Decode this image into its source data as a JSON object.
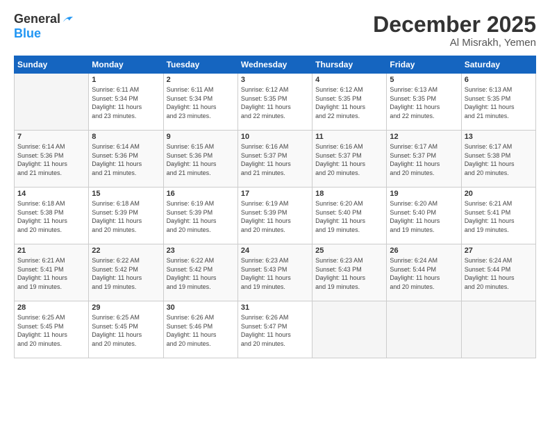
{
  "logo": {
    "line1": "General",
    "line2": "Blue"
  },
  "header": {
    "month": "December 2025",
    "location": "Al Misrakh, Yemen"
  },
  "days_of_week": [
    "Sunday",
    "Monday",
    "Tuesday",
    "Wednesday",
    "Thursday",
    "Friday",
    "Saturday"
  ],
  "weeks": [
    [
      {
        "day": "",
        "empty": true
      },
      {
        "day": "1",
        "sunrise": "6:11 AM",
        "sunset": "5:34 PM",
        "daylight": "11 hours and 23 minutes."
      },
      {
        "day": "2",
        "sunrise": "6:11 AM",
        "sunset": "5:34 PM",
        "daylight": "11 hours and 23 minutes."
      },
      {
        "day": "3",
        "sunrise": "6:12 AM",
        "sunset": "5:35 PM",
        "daylight": "11 hours and 22 minutes."
      },
      {
        "day": "4",
        "sunrise": "6:12 AM",
        "sunset": "5:35 PM",
        "daylight": "11 hours and 22 minutes."
      },
      {
        "day": "5",
        "sunrise": "6:13 AM",
        "sunset": "5:35 PM",
        "daylight": "11 hours and 22 minutes."
      },
      {
        "day": "6",
        "sunrise": "6:13 AM",
        "sunset": "5:35 PM",
        "daylight": "11 hours and 21 minutes."
      }
    ],
    [
      {
        "day": "7",
        "sunrise": "6:14 AM",
        "sunset": "5:36 PM",
        "daylight": "11 hours and 21 minutes."
      },
      {
        "day": "8",
        "sunrise": "6:14 AM",
        "sunset": "5:36 PM",
        "daylight": "11 hours and 21 minutes."
      },
      {
        "day": "9",
        "sunrise": "6:15 AM",
        "sunset": "5:36 PM",
        "daylight": "11 hours and 21 minutes."
      },
      {
        "day": "10",
        "sunrise": "6:16 AM",
        "sunset": "5:37 PM",
        "daylight": "11 hours and 21 minutes."
      },
      {
        "day": "11",
        "sunrise": "6:16 AM",
        "sunset": "5:37 PM",
        "daylight": "11 hours and 20 minutes."
      },
      {
        "day": "12",
        "sunrise": "6:17 AM",
        "sunset": "5:37 PM",
        "daylight": "11 hours and 20 minutes."
      },
      {
        "day": "13",
        "sunrise": "6:17 AM",
        "sunset": "5:38 PM",
        "daylight": "11 hours and 20 minutes."
      }
    ],
    [
      {
        "day": "14",
        "sunrise": "6:18 AM",
        "sunset": "5:38 PM",
        "daylight": "11 hours and 20 minutes."
      },
      {
        "day": "15",
        "sunrise": "6:18 AM",
        "sunset": "5:39 PM",
        "daylight": "11 hours and 20 minutes."
      },
      {
        "day": "16",
        "sunrise": "6:19 AM",
        "sunset": "5:39 PM",
        "daylight": "11 hours and 20 minutes."
      },
      {
        "day": "17",
        "sunrise": "6:19 AM",
        "sunset": "5:39 PM",
        "daylight": "11 hours and 20 minutes."
      },
      {
        "day": "18",
        "sunrise": "6:20 AM",
        "sunset": "5:40 PM",
        "daylight": "11 hours and 19 minutes."
      },
      {
        "day": "19",
        "sunrise": "6:20 AM",
        "sunset": "5:40 PM",
        "daylight": "11 hours and 19 minutes."
      },
      {
        "day": "20",
        "sunrise": "6:21 AM",
        "sunset": "5:41 PM",
        "daylight": "11 hours and 19 minutes."
      }
    ],
    [
      {
        "day": "21",
        "sunrise": "6:21 AM",
        "sunset": "5:41 PM",
        "daylight": "11 hours and 19 minutes."
      },
      {
        "day": "22",
        "sunrise": "6:22 AM",
        "sunset": "5:42 PM",
        "daylight": "11 hours and 19 minutes."
      },
      {
        "day": "23",
        "sunrise": "6:22 AM",
        "sunset": "5:42 PM",
        "daylight": "11 hours and 19 minutes."
      },
      {
        "day": "24",
        "sunrise": "6:23 AM",
        "sunset": "5:43 PM",
        "daylight": "11 hours and 19 minutes."
      },
      {
        "day": "25",
        "sunrise": "6:23 AM",
        "sunset": "5:43 PM",
        "daylight": "11 hours and 19 minutes."
      },
      {
        "day": "26",
        "sunrise": "6:24 AM",
        "sunset": "5:44 PM",
        "daylight": "11 hours and 20 minutes."
      },
      {
        "day": "27",
        "sunrise": "6:24 AM",
        "sunset": "5:44 PM",
        "daylight": "11 hours and 20 minutes."
      }
    ],
    [
      {
        "day": "28",
        "sunrise": "6:25 AM",
        "sunset": "5:45 PM",
        "daylight": "11 hours and 20 minutes."
      },
      {
        "day": "29",
        "sunrise": "6:25 AM",
        "sunset": "5:45 PM",
        "daylight": "11 hours and 20 minutes."
      },
      {
        "day": "30",
        "sunrise": "6:26 AM",
        "sunset": "5:46 PM",
        "daylight": "11 hours and 20 minutes."
      },
      {
        "day": "31",
        "sunrise": "6:26 AM",
        "sunset": "5:47 PM",
        "daylight": "11 hours and 20 minutes."
      },
      {
        "day": "",
        "empty": true
      },
      {
        "day": "",
        "empty": true
      },
      {
        "day": "",
        "empty": true
      }
    ]
  ]
}
